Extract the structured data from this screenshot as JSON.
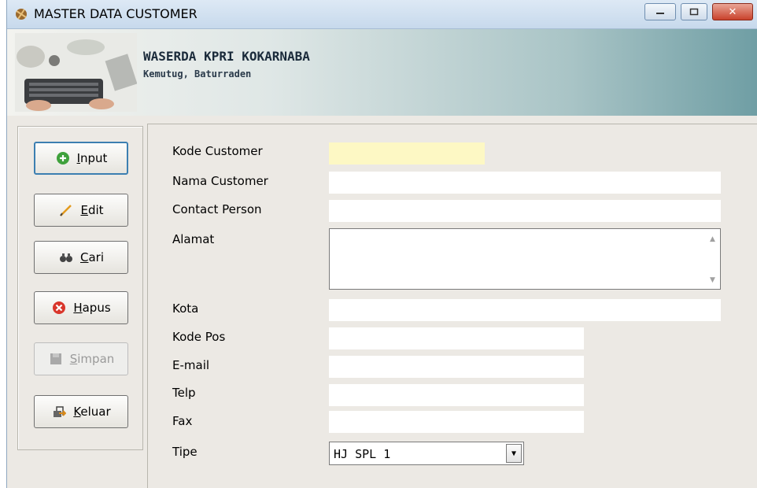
{
  "window": {
    "title": "MASTER DATA CUSTOMER",
    "close_symbol": "✕"
  },
  "banner": {
    "title": "WASERDA KPRI KOKARNABA",
    "subtitle": "Kemutug, Baturraden"
  },
  "buttons": {
    "input": {
      "label": "Input",
      "icon": "add-icon"
    },
    "edit": {
      "label": "Edit",
      "icon": "pencil-icon"
    },
    "cari": {
      "label": "Cari",
      "icon": "binoculars-icon"
    },
    "hapus": {
      "label": "Hapus",
      "icon": "delete-icon"
    },
    "simpan": {
      "label": "Simpan",
      "icon": "save-icon"
    },
    "keluar": {
      "label": "Keluar",
      "icon": "exit-icon"
    }
  },
  "form": {
    "kode_customer": {
      "label": "Kode Customer",
      "value": ""
    },
    "nama_customer": {
      "label": "Nama Customer",
      "value": ""
    },
    "contact_person": {
      "label": "Contact Person",
      "value": ""
    },
    "alamat": {
      "label": "Alamat",
      "value": ""
    },
    "kota": {
      "label": "Kota",
      "value": ""
    },
    "kode_pos": {
      "label": "Kode Pos",
      "value": ""
    },
    "email": {
      "label": "E-mail",
      "value": ""
    },
    "telp": {
      "label": "Telp",
      "value": ""
    },
    "fax": {
      "label": "Fax",
      "value": ""
    },
    "tipe": {
      "label": "Tipe",
      "value": "HJ SPL 1"
    }
  },
  "colors": {
    "kode_field_bg": "#fdf8c4",
    "close_button": "#c9422c",
    "focus_border": "#3c7fb1"
  }
}
